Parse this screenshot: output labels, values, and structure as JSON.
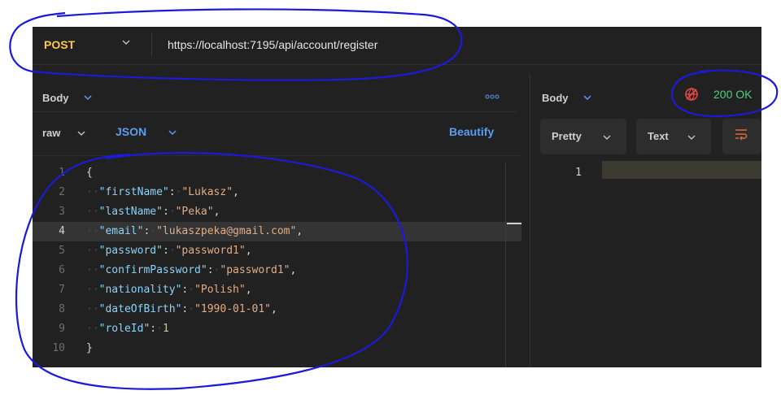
{
  "request": {
    "method": "POST",
    "url": "https://localhost:7195/api/account/register",
    "body_tab": "Body",
    "raw_label": "raw",
    "json_label": "JSON",
    "beautify_label": "Beautify",
    "lines": [
      {
        "num": "1"
      },
      {
        "num": "2",
        "key": "\"firstName\"",
        "value": "\"Lukasz\""
      },
      {
        "num": "3",
        "key": "\"lastName\"",
        "value": "\"Peka\""
      },
      {
        "num": "4",
        "key": "\"email\"",
        "value": "\"lukaszpeka@gmail.com\""
      },
      {
        "num": "5",
        "key": "\"password\"",
        "value": "\"password1\""
      },
      {
        "num": "6",
        "key": "\"confirmPassword\"",
        "value": "\"password1\""
      },
      {
        "num": "7",
        "key": "\"nationality\"",
        "value": "\"Polish\""
      },
      {
        "num": "8",
        "key": "\"dateOfBirth\"",
        "value": "\"1990-01-01\""
      },
      {
        "num": "9",
        "key": "\"roleId\"",
        "value": "1"
      },
      {
        "num": "10"
      }
    ]
  },
  "response": {
    "body_tab": "Body",
    "status": "200 OK",
    "pretty_label": "Pretty",
    "text_label": "Text",
    "line_num": "1"
  },
  "colors": {
    "method": "#ffc64a",
    "accent": "#5b9cf5",
    "status_ok": "#4cd07d",
    "annotation": "#1a1ad8"
  },
  "icons": [
    "chevron-down-icon",
    "more-icon",
    "status-error-icon",
    "wrap-lines-icon"
  ]
}
